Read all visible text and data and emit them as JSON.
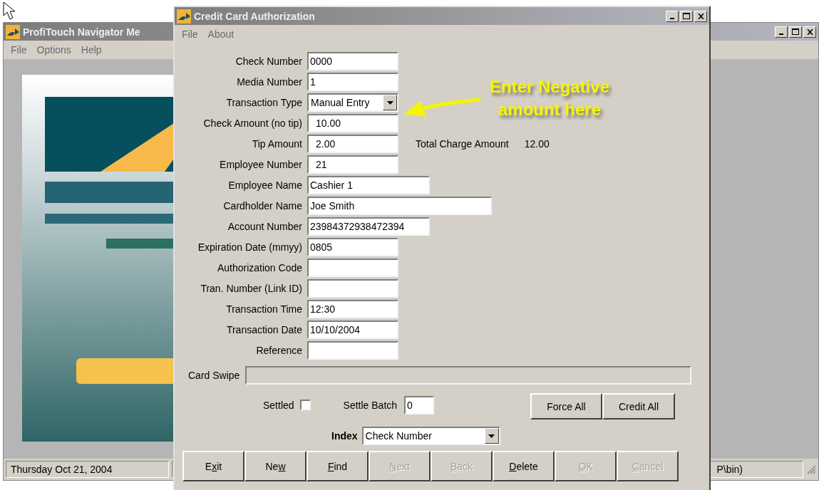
{
  "main_window": {
    "title": "ProfiTouch Navigator Me",
    "menu": [
      "File",
      "Options",
      "Help"
    ],
    "logo": {
      "kind": "picture"
    },
    "status_bar": [
      "Thursday  Oct 21, 2004",
      "P\\bin)"
    ]
  },
  "dialog": {
    "title": "Credit Card Authorization",
    "menu": [
      "File",
      "About"
    ],
    "fields": [
      {
        "label": "Check Number",
        "value": "0000",
        "kind": "text",
        "indented": false
      },
      {
        "label": "Media Number",
        "value": "1",
        "kind": "text",
        "indented": false
      },
      {
        "label": "Transaction Type",
        "value": "Manual Entry",
        "kind": "dropdown"
      },
      {
        "label": "Check Amount (no tip)",
        "value": "10.00",
        "kind": "text",
        "indented": true
      },
      {
        "label": "Tip Amount",
        "value": "2.00",
        "kind": "text",
        "indented": true,
        "note": {
          "label": "Total Charge Amount",
          "value": "12.00"
        }
      },
      {
        "label": "Employee Number",
        "value": "21",
        "kind": "text",
        "indented": true
      },
      {
        "label": "Employee Name",
        "value": "Cashier 1",
        "kind": "text",
        "indented": false
      },
      {
        "label": "Cardholder Name",
        "value": "Joe Smith",
        "kind": "text",
        "indented": false
      },
      {
        "label": "Account Number",
        "value": "23984372938472394",
        "kind": "text",
        "indented": false
      },
      {
        "label": "Expiration Date (mmyy)",
        "value": "0805",
        "kind": "text",
        "indented": false
      },
      {
        "label": "Authorization Code",
        "kind": "text"
      },
      {
        "label": "Tran. Number (Link ID)",
        "kind": "text"
      },
      {
        "label": "Transaction Time",
        "value": "12:30",
        "kind": "text",
        "indented": false
      },
      {
        "label": "Transaction Date",
        "value": "10/10/2004",
        "kind": "text",
        "indented": false
      },
      {
        "label": "Reference",
        "kind": "text"
      }
    ],
    "card_swipe": {
      "label": "Card Swipe",
      "disabled": true
    },
    "settled": {
      "label": "Settled",
      "checked": false
    },
    "settle_batch": {
      "label": "Settle Batch",
      "value": "0"
    },
    "side_buttons": [
      "Force All",
      "Credit All"
    ],
    "index": {
      "label": "Index",
      "value": "Check Number"
    },
    "buttons": [
      {
        "parts": [
          {
            "text": "E",
            "underlined": false
          },
          {
            "text": "x",
            "underlined": true
          },
          {
            "text": "it",
            "underlined": false
          }
        ],
        "disabled": false
      },
      {
        "parts": [
          {
            "text": "Ne",
            "underlined": false
          },
          {
            "text": "w",
            "underlined": true
          }
        ],
        "disabled": false
      },
      {
        "parts": [
          {
            "text": "F",
            "underlined": true
          },
          {
            "text": "ind",
            "underlined": false
          }
        ],
        "disabled": false
      },
      {
        "parts": [
          {
            "text": "N",
            "underlined": true
          },
          {
            "text": "ext",
            "underlined": false
          }
        ],
        "disabled": true
      },
      {
        "parts": [
          {
            "text": "B",
            "underlined": true
          },
          {
            "text": "ack",
            "underlined": false
          }
        ],
        "disabled": true
      },
      {
        "parts": [
          {
            "text": "D",
            "underlined": true
          },
          {
            "text": "elete",
            "underlined": false
          }
        ],
        "disabled": false
      },
      {
        "parts": [
          {
            "text": "O",
            "underlined": true
          },
          {
            "text": "K",
            "underlined": false
          }
        ],
        "disabled": true
      },
      {
        "parts": [
          {
            "text": "C",
            "underlined": true
          },
          {
            "text": "ancel",
            "underlined": false
          }
        ],
        "disabled": true
      }
    ]
  },
  "annotation": {
    "text": "Enter Negative amount here"
  }
}
